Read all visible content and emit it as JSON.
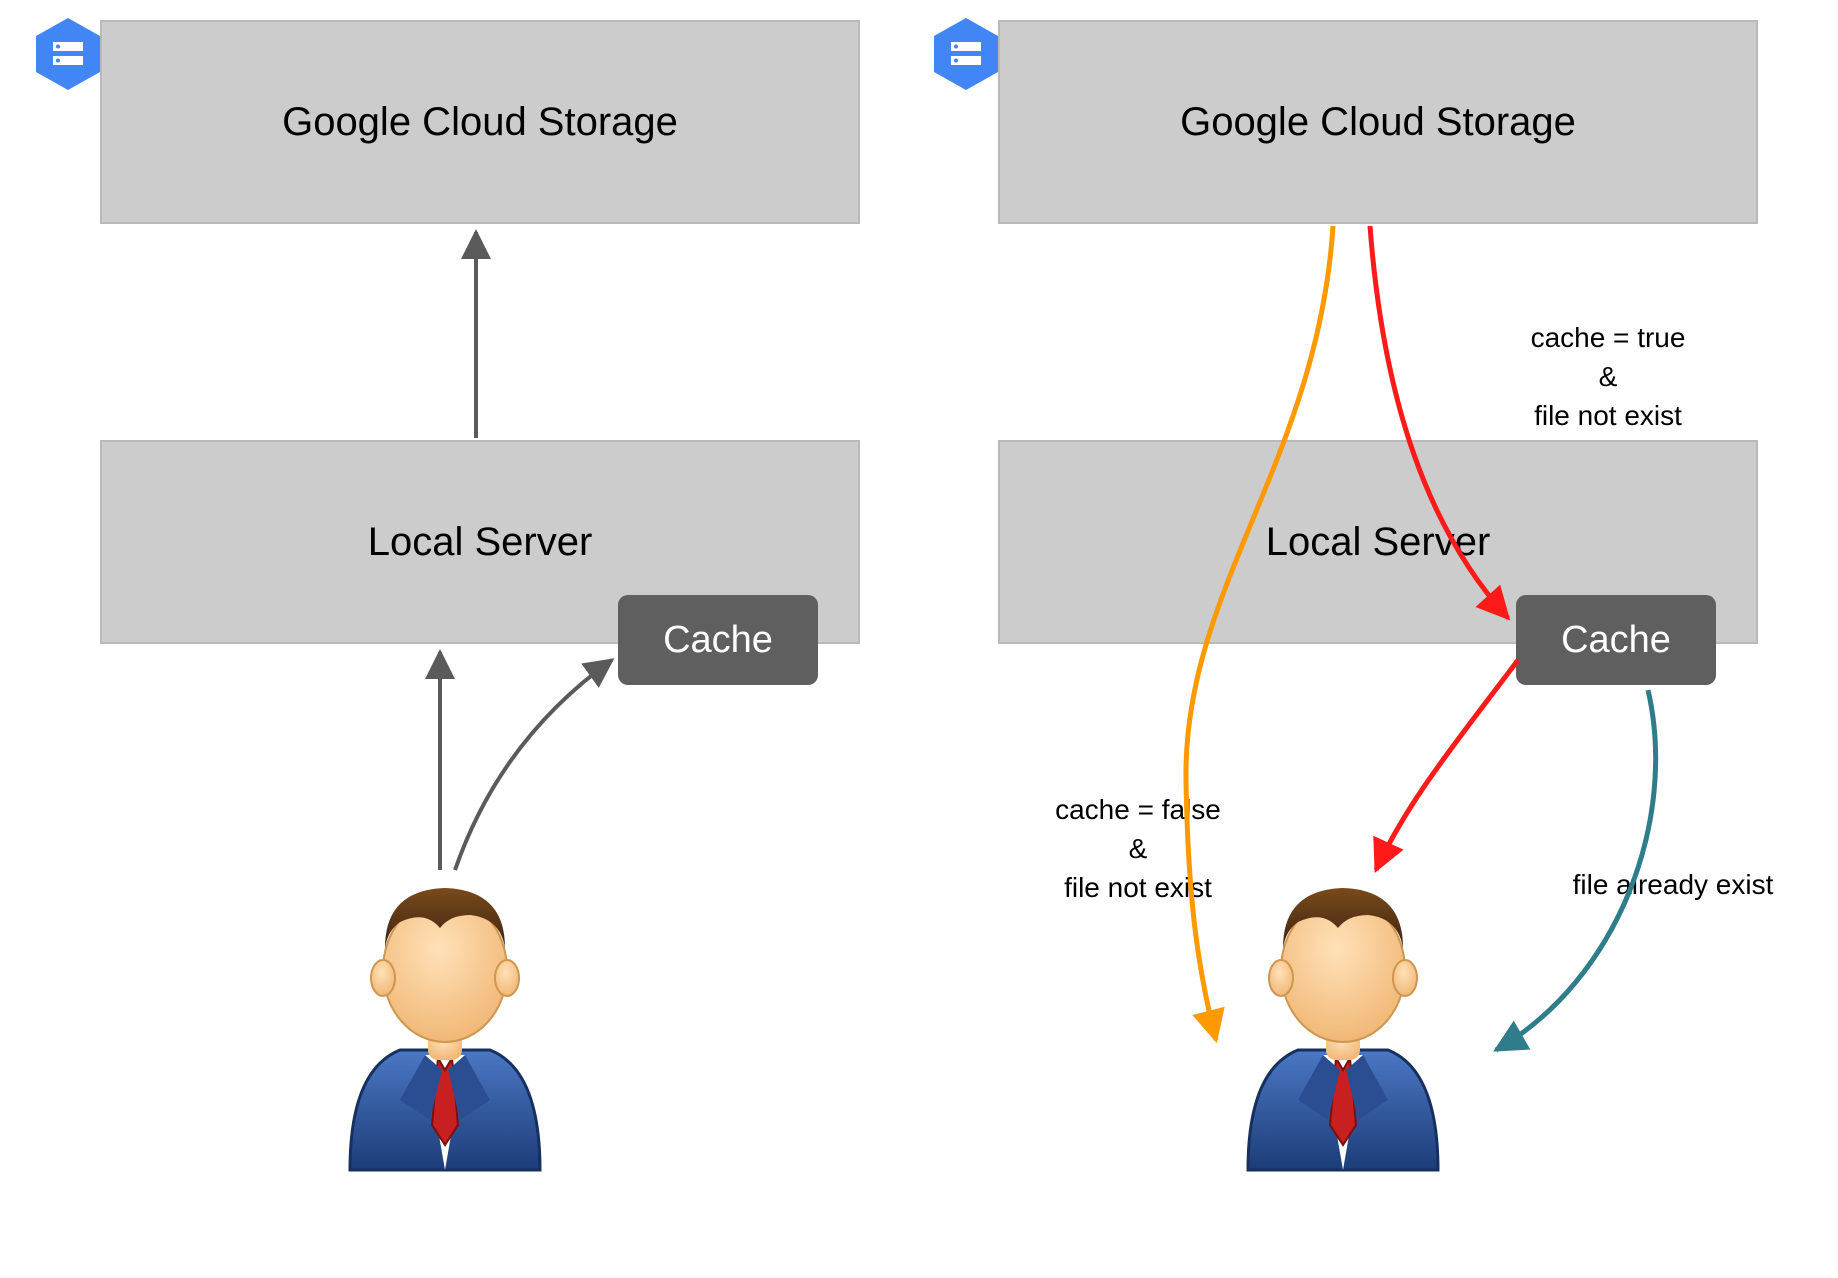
{
  "left": {
    "cloud_label": "Google Cloud Storage",
    "server_label": "Local Server",
    "cache_label": "Cache"
  },
  "right": {
    "cloud_label": "Google Cloud Storage",
    "server_label": "Local Server",
    "cache_label": "Cache",
    "annotations": {
      "cache_true": "cache = true\n&\nfile not exist",
      "cache_false": "cache = false\n&\nfile not exist",
      "file_already": "file already exist"
    }
  },
  "colors": {
    "box_fill": "#cccccc",
    "cache_fill": "#5f5f5f",
    "hex_fill": "#4285f4",
    "arrow_gray": "#5a5a5a",
    "arrow_orange": "#ff9900",
    "arrow_red": "#ff1a1a",
    "arrow_teal": "#2f7d8a"
  }
}
